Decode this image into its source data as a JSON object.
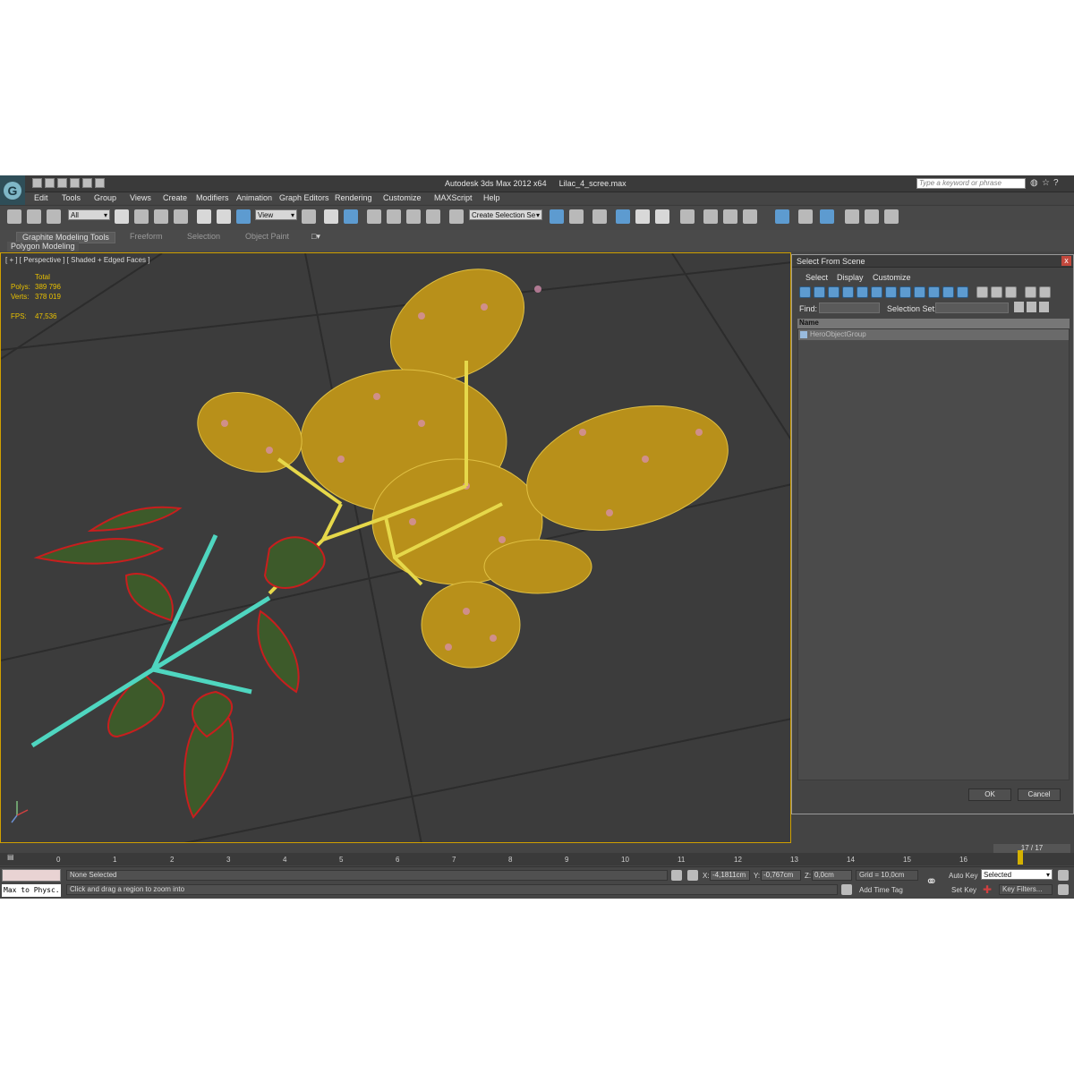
{
  "app": {
    "logo_glyph": "G",
    "title": "Autodesk 3ds Max  2012 x64",
    "filename": "Lilac_4_scree.max",
    "search_placeholder": "Type a keyword or phrase"
  },
  "menu": [
    "Edit",
    "Tools",
    "Group",
    "Views",
    "Create",
    "Modifiers",
    "Animation",
    "Graph Editors",
    "Rendering",
    "Customize",
    "MAXScript",
    "Help"
  ],
  "toolbar": {
    "selection_filter": "All",
    "reference_coord": "View",
    "named_selection": "Create Selection Se"
  },
  "ribbon": {
    "tabs": [
      "Graphite Modeling Tools",
      "Freeform",
      "Selection",
      "Object Paint"
    ],
    "panel": "Polygon Modeling"
  },
  "viewport": {
    "label": "[ + ] [ Perspective ] [ Shaded + Edged Faces ]",
    "stats": {
      "total_label": "Total",
      "polys_label": "Polys:",
      "polys_value": "389 796",
      "verts_label": "Verts:",
      "verts_value": "378 019",
      "fps_label": "FPS:",
      "fps_value": "47,536"
    },
    "colors": {
      "flowers": "#b8901a",
      "leaves": "#3d5a2a",
      "leaf_wire": "#c81e1e",
      "stem": "#e6d84a",
      "branch": "#4fd6c0"
    }
  },
  "dialog": {
    "title": "Select From Scene",
    "close_glyph": "x",
    "menu": [
      "Select",
      "Display",
      "Customize"
    ],
    "find_label": "Find:",
    "selection_set_label": "Selection Set:",
    "column_header": "Name",
    "items": [
      "HeroObjectGroup"
    ],
    "ok_label": "OK",
    "cancel_label": "Cancel"
  },
  "timeline": {
    "frame_counter": "17 / 17",
    "ticks": [
      "0",
      "1",
      "2",
      "3",
      "4",
      "5",
      "6",
      "7",
      "8",
      "9",
      "10",
      "11",
      "12",
      "13",
      "14",
      "15",
      "16"
    ],
    "current_frame": 17
  },
  "status": {
    "maxscript_text": "Max to Physc.",
    "selection_status": "None Selected",
    "prompt": "Click and drag a region to zoom into",
    "x_label": "X:",
    "x_value": "-4,1811cm",
    "y_label": "Y:",
    "y_value": "-0,767cm",
    "z_label": "Z:",
    "z_value": "0,0cm",
    "grid": "Grid = 10,0cm",
    "add_time_tag": "Add Time Tag",
    "auto_key": "Auto Key",
    "set_key": "Set Key",
    "key_mode": "Selected",
    "key_filters": "Key Filters..."
  }
}
